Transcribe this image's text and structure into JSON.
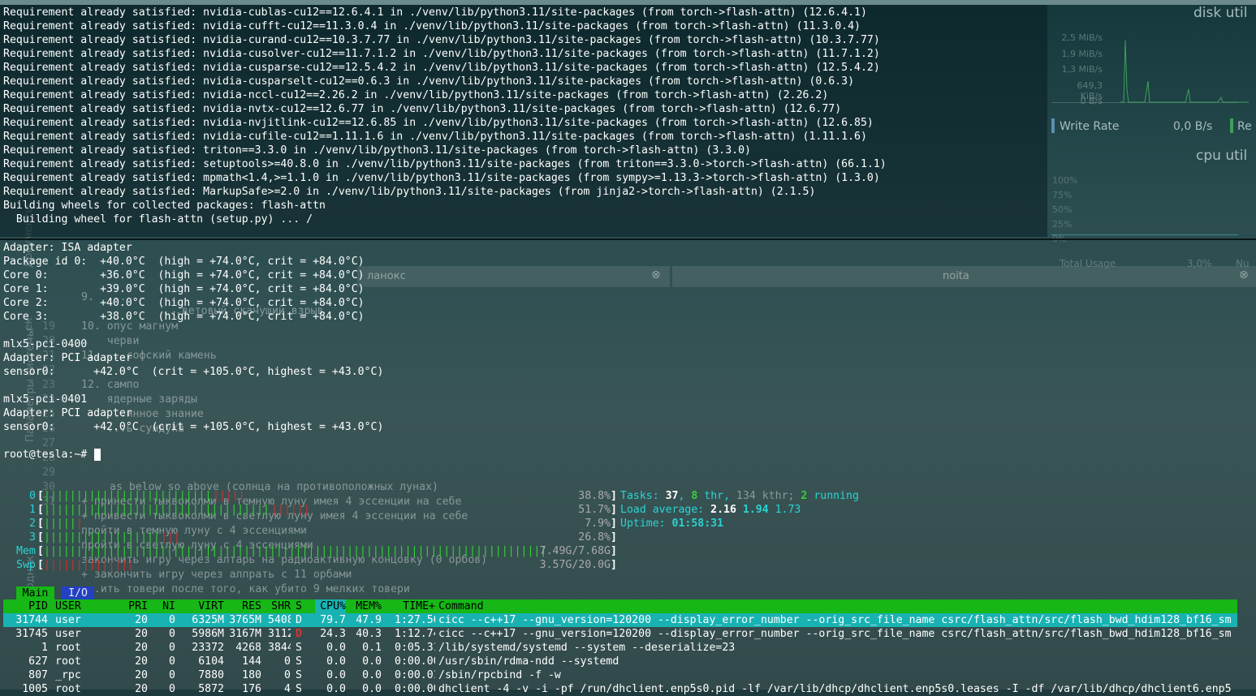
{
  "terminal_top": {
    "lines": [
      "Requirement already satisfied: nvidia-cublas-cu12==12.6.4.1 in ./venv/lib/python3.11/site-packages (from torch->flash-attn) (12.6.4.1)",
      "Requirement already satisfied: nvidia-cufft-cu12==11.3.0.4 in ./venv/lib/python3.11/site-packages (from torch->flash-attn) (11.3.0.4)",
      "Requirement already satisfied: nvidia-curand-cu12==10.3.7.77 in ./venv/lib/python3.11/site-packages (from torch->flash-attn) (10.3.7.77)",
      "Requirement already satisfied: nvidia-cusolver-cu12==11.7.1.2 in ./venv/lib/python3.11/site-packages (from torch->flash-attn) (11.7.1.2)",
      "Requirement already satisfied: nvidia-cusparse-cu12==12.5.4.2 in ./venv/lib/python3.11/site-packages (from torch->flash-attn) (12.5.4.2)",
      "Requirement already satisfied: nvidia-cusparselt-cu12==0.6.3 in ./venv/lib/python3.11/site-packages (from torch->flash-attn) (0.6.3)",
      "Requirement already satisfied: nvidia-nccl-cu12==2.26.2 in ./venv/lib/python3.11/site-packages (from torch->flash-attn) (2.26.2)",
      "Requirement already satisfied: nvidia-nvtx-cu12==12.6.77 in ./venv/lib/python3.11/site-packages (from torch->flash-attn) (12.6.77)",
      "Requirement already satisfied: nvidia-nvjitlink-cu12==12.6.85 in ./venv/lib/python3.11/site-packages (from torch->flash-attn) (12.6.85)",
      "Requirement already satisfied: nvidia-cufile-cu12==1.11.1.6 in ./venv/lib/python3.11/site-packages (from torch->flash-attn) (1.11.1.6)",
      "Requirement already satisfied: triton==3.3.0 in ./venv/lib/python3.11/site-packages (from torch->flash-attn) (3.3.0)",
      "Requirement already satisfied: setuptools>=40.8.0 in ./venv/lib/python3.11/site-packages (from triton==3.3.0->torch->flash-attn) (66.1.1)",
      "Requirement already satisfied: mpmath<1.4,>=1.1.0 in ./venv/lib/python3.11/site-packages (from sympy>=1.13.3->torch->flash-attn) (1.3.0)",
      "Requirement already satisfied: MarkupSafe>=2.0 in ./venv/lib/python3.11/site-packages (from jinja2->torch->flash-attn) (2.1.5)",
      "Building wheels for collected packages: flash-attn",
      "  Building wheel for flash-attn (setup.py) ... /"
    ]
  },
  "sensors": {
    "lines": [
      "Adapter: ISA adapter",
      "Package id 0:  +40.0°C  (high = +74.0°C, crit = +84.0°C)",
      "Core 0:        +36.0°C  (high = +74.0°C, crit = +84.0°C)",
      "Core 1:        +39.0°C  (high = +74.0°C, crit = +84.0°C)",
      "Core 2:        +40.0°C  (high = +74.0°C, crit = +84.0°C)",
      "Core 3:        +38.0°C  (high = +74.0°C, crit = +84.0°C)",
      "",
      "mlx5-pci-0400",
      "Adapter: PCI adapter",
      "sensor0:      +42.0°C  (crit = +105.0°C, highest = +43.0°C)",
      "",
      "mlx5-pci-0401",
      "Adapter: PCI adapter",
      "sensor0:      +42.0°C  (crit = +105.0°C, highest = +43.0°C)",
      "",
      "root@tesla:~# "
    ]
  },
  "background_window": {
    "tabs": [
      "ланокс",
      "noita"
    ],
    "numbered_items": [
      "9.  ...",
      "10. опус магнум",
      "    черви",
      "11. ...софский камень",
      "12. сампо",
      "    ядерные заряды",
      "    ...инное знание",
      "    ...ь сундука"
    ],
    "text": [
      "as below so above (солнца на противоположных лунах)",
      "+ принести тыквоколми в темную луну имея 4 эссенции на себе",
      "+ привести тыквоколми в светлую луну имея 4 эссенции на себе",
      "пройти в темную луну с 4 эссенциями",
      "пройти в светлую луну с 4 эссенциями",
      "закончить игру через алтарь на радиоактивную концовку (0 орбов)",
      "+ закончить игру через алпрать с 11 орбами",
      "...ить товери после того, как убито 9 мелких товери"
    ],
    "sidebar_labels": [
      "Документы",
      "...ек",
      "Параметры системы",
      "Проводник"
    ],
    "extra": "...ветовый скачущий взрыв",
    "line_numbers": [
      "19",
      "20",
      "21",
      "22",
      "23",
      "24",
      "25",
      "26",
      "27",
      "28",
      "29",
      "30",
      "31"
    ]
  },
  "right_widgets": {
    "disk_title": "disk util",
    "disk_axis": [
      "2,5 MiB/s",
      "1,9 MiB/s",
      "1,3 MiB/s",
      "649,3 KiB/s",
      "0 B/s"
    ],
    "write_rate_label": "Write Rate",
    "write_rate_value": "0,0 B/s",
    "read_rate_label": "Re",
    "cpu_title": "cpu util",
    "cpu_axis": [
      "100%",
      "75%",
      "50%",
      "25%",
      "0%"
    ],
    "total_usage_label": "Total Usage",
    "total_usage_value": "3,0%",
    "total_usage_extra": "Nu"
  },
  "htop": {
    "cpus": [
      {
        "label": "0",
        "percent": "38.8%",
        "fraction": 0.388
      },
      {
        "label": "1",
        "percent": "51.7%",
        "fraction": 0.517
      },
      {
        "label": "2",
        "percent": "7.9%",
        "fraction": 0.079
      },
      {
        "label": "3",
        "percent": "26.8%",
        "fraction": 0.268
      }
    ],
    "mem": {
      "label": "Mem",
      "value": "7.49G/7.68G",
      "fraction": 0.975
    },
    "swp": {
      "label": "Swp",
      "value": "3.57G/20.0G",
      "fraction": 0.1785
    },
    "tasks_label": "Tasks:",
    "tasks": "37",
    "thr": "8",
    "thr_label": "thr,",
    "kthr": "134 kthr;",
    "running": "2",
    "running_label": "running",
    "load_label": "Load average:",
    "load1": "2.16",
    "load5": "1.94",
    "load15": "1.73",
    "uptime_label": "Uptime:",
    "uptime": "01:58:31",
    "tab_main": "Main",
    "tab_io": "I/O",
    "columns": [
      "PID",
      "USER",
      "PRI",
      "NI",
      "VIRT",
      "RES",
      "SHR",
      "S",
      "CPU%",
      "MEM%",
      "TIME+",
      "Command"
    ],
    "rows": [
      {
        "pid": "31744",
        "user": "user",
        "pri": "20",
        "ni": "0",
        "virt": "6325M",
        "res": "3765M",
        "shr": "5408",
        "s": "D",
        "cpu": "79.7",
        "mem": "47.9",
        "time": "1:27.56",
        "cmd": "cicc --c++17 --gnu_version=120200 --display_error_number --orig_src_file_name csrc/flash_attn/src/flash_bwd_hdim128_bf16_sm"
      },
      {
        "pid": "31745",
        "user": "user",
        "pri": "20",
        "ni": "0",
        "virt": "5986M",
        "res": "3167M",
        "shr": "3112",
        "s": "D",
        "cpu": "24.3",
        "mem": "40.3",
        "time": "1:12.74",
        "cmd": "cicc --c++17 --gnu_version=120200 --display_error_number --orig_src_file_name csrc/flash_attn/src/flash_bwd_hdim128_bf16_sm"
      },
      {
        "pid": "1",
        "user": "root",
        "pri": "20",
        "ni": "0",
        "virt": "23372",
        "res": "4268",
        "shr": "3844",
        "s": "S",
        "cpu": "0.0",
        "mem": "0.1",
        "time": "0:05.31",
        "cmd": "/lib/systemd/systemd --system --deserialize=23"
      },
      {
        "pid": "627",
        "user": "root",
        "pri": "20",
        "ni": "0",
        "virt": "6104",
        "res": "144",
        "shr": "0",
        "s": "S",
        "cpu": "0.0",
        "mem": "0.0",
        "time": "0:00.00",
        "cmd": "/usr/sbin/rdma-ndd --systemd"
      },
      {
        "pid": "807",
        "user": "_rpc",
        "pri": "20",
        "ni": "0",
        "virt": "7880",
        "res": "180",
        "shr": "0",
        "s": "S",
        "cpu": "0.0",
        "mem": "0.0",
        "time": "0:00.01",
        "cmd": "/sbin/rpcbind -f -w"
      },
      {
        "pid": "1005",
        "user": "root",
        "pri": "20",
        "ni": "0",
        "virt": "5872",
        "res": "176",
        "shr": "4",
        "s": "S",
        "cpu": "0.0",
        "mem": "0.0",
        "time": "0:00.00",
        "cmd": "dhclient -4 -v -i -pf /run/dhclient.enp5s0.pid -lf /var/lib/dhcp/dhclient.enp5s0.leases -I -df /var/lib/dhcp/dhclient6.enp5"
      }
    ]
  },
  "colors": {
    "htop_green": "#16b716",
    "htop_cyan": "#19b2b2",
    "io_blue": "#2240c0",
    "cursor": "#ffffff"
  }
}
